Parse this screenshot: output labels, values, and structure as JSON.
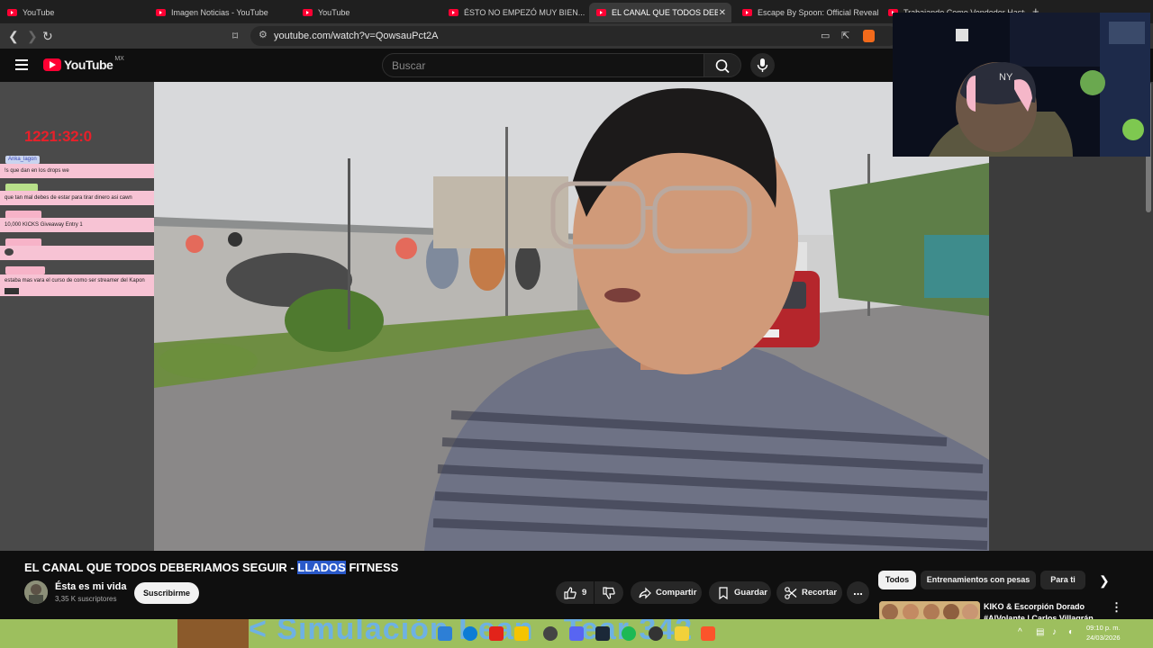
{
  "browser": {
    "tabs": [
      {
        "label": "YouTube",
        "active": false
      },
      {
        "label": "Imagen Noticias - YouTube",
        "active": false
      },
      {
        "label": "YouTube",
        "active": false
      },
      {
        "label": "ÉSTO NO EMPEZÓ MUY BIEN... - You",
        "active": false
      },
      {
        "label": "EL CANAL QUE TODOS DEBERIA",
        "active": true
      },
      {
        "label": "Escape By Spoon: Official Reveal Trai",
        "active": false
      },
      {
        "label": "Trabajando Como Vendedor Hasta C",
        "active": false
      }
    ],
    "new_tab": "+",
    "url": "youtube.com/watch?v=QowsauPct2A"
  },
  "youtube": {
    "logo_text": "YouTube",
    "country_code": "MX",
    "search_placeholder": "Buscar"
  },
  "stream_overlay": {
    "timer": "1221:32:0",
    "chat": [
      {
        "user": "Anka_lagon",
        "message": "!s que dan en los drops we"
      },
      {
        "user": "",
        "message": "que tan mal debes de estar para tirar dinero asi cawn"
      },
      {
        "user": "",
        "message": "10,000 KICKS Giveaway Entry 1"
      },
      {
        "user": "",
        "message": ""
      },
      {
        "user": "",
        "message": "estaba mas vara el curso de como ser streamer del Kapon"
      }
    ]
  },
  "video": {
    "title_prefix": "EL CANAL QUE TODOS DEBERIAMOS SEGUIR - ",
    "title_highlight": "LLADOS",
    "title_suffix": " FITNESS",
    "channel_name": "Ésta es mi vida",
    "subscribers": "3,35 K suscriptores",
    "subscribe_label": "Suscribirme",
    "like_count": "9",
    "share_label": "Compartir",
    "save_label": "Guardar",
    "clip_label": "Recortar",
    "more_label": "..."
  },
  "sidebar": {
    "chips": [
      "Todos",
      "Entrenamientos con pesas",
      "Para ti"
    ],
    "recommendation_title": "KIKO & Escorpión Dorado #AlVolante | Carlos Villagrán"
  },
  "taskbar": {
    "banner_text": "< Simulación Lean - Tear 342",
    "time": "09:10 p. m.",
    "date": "24/03/2026"
  },
  "colors": {
    "youtube_red": "#ff0033",
    "timer_red": "#e8202a",
    "chat_pink": "#f7c3d4",
    "highlight_blue": "#2a59c9",
    "taskbar_green": "#9dbf5e"
  }
}
